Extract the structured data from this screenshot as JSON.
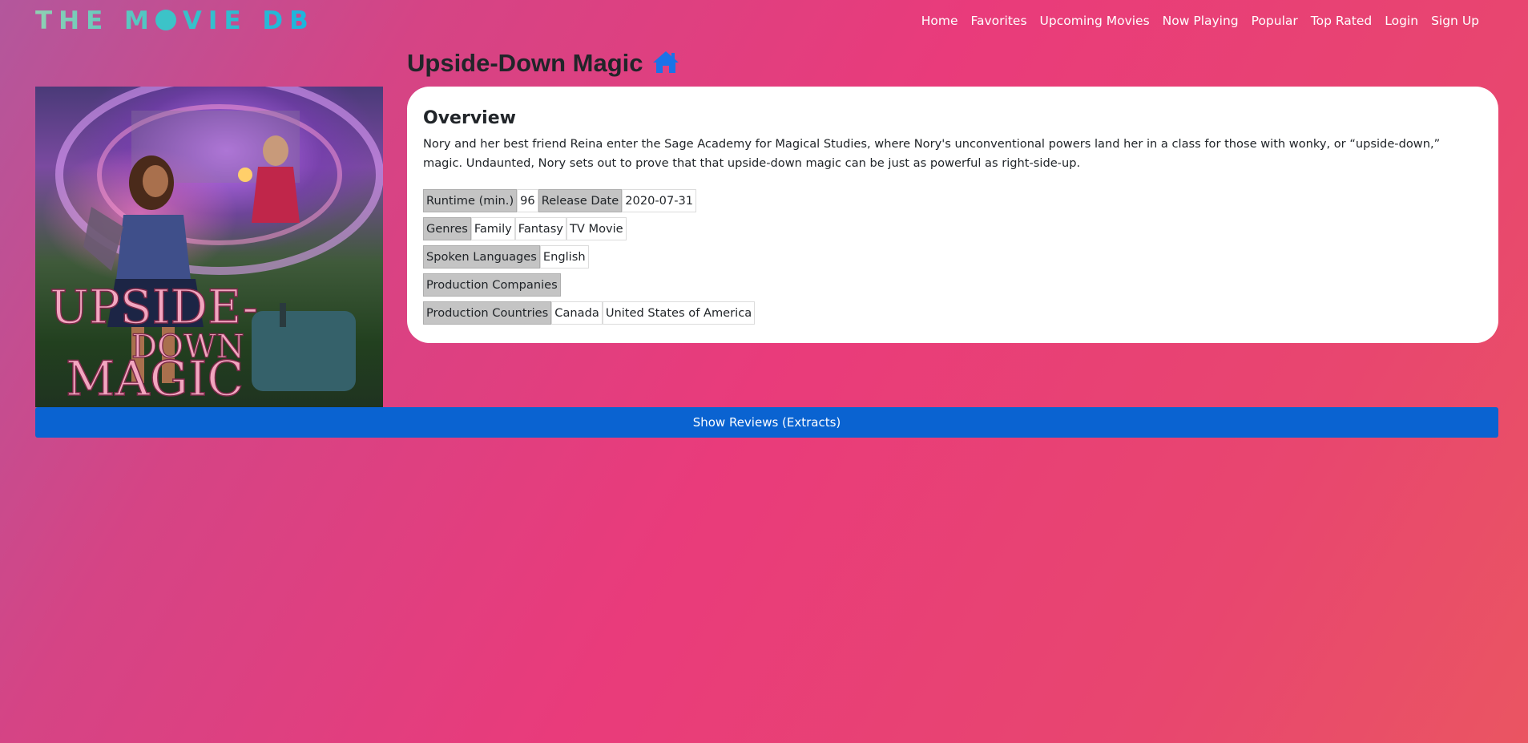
{
  "brand": {
    "logo_part1": "THE M",
    "logo_part2": "VIE DB"
  },
  "nav": {
    "items": [
      "Home",
      "Favorites",
      "Upcoming Movies",
      "Now Playing",
      "Popular",
      "Top Rated",
      "Login",
      "Sign Up"
    ]
  },
  "movie": {
    "title": "Upside-Down Magic",
    "home_icon": "home-icon",
    "poster_icon": "movie-poster-image",
    "poster_text_line1": "UPSIDE-",
    "poster_text_line2": "DOWN",
    "poster_text_line3": "MAGIC"
  },
  "overview": {
    "heading": "Overview",
    "text": "Nory and her best friend Reina enter the Sage Academy for Magical Studies, where Nory's unconventional powers land her in a class for those with wonky, or “upside-down,” magic. Undaunted, Nory sets out to prove that that upside-down magic can be just as powerful as right-side-up."
  },
  "details": {
    "runtime_label": "Runtime (min.)",
    "runtime_value": "96",
    "release_label": "Release Date",
    "release_value": "2020-07-31",
    "genres_label": "Genres",
    "genres": [
      "Family",
      "Fantasy",
      "TV Movie"
    ],
    "languages_label": "Spoken Languages",
    "languages": [
      "English"
    ],
    "companies_label": "Production Companies",
    "countries_label": "Production Countries",
    "countries": [
      "Canada",
      "United States of America"
    ]
  },
  "reviews_button": "Show Reviews (Extracts)",
  "colors": {
    "accent_blue": "#0a63d1",
    "home_icon_blue": "#1a73e8"
  }
}
